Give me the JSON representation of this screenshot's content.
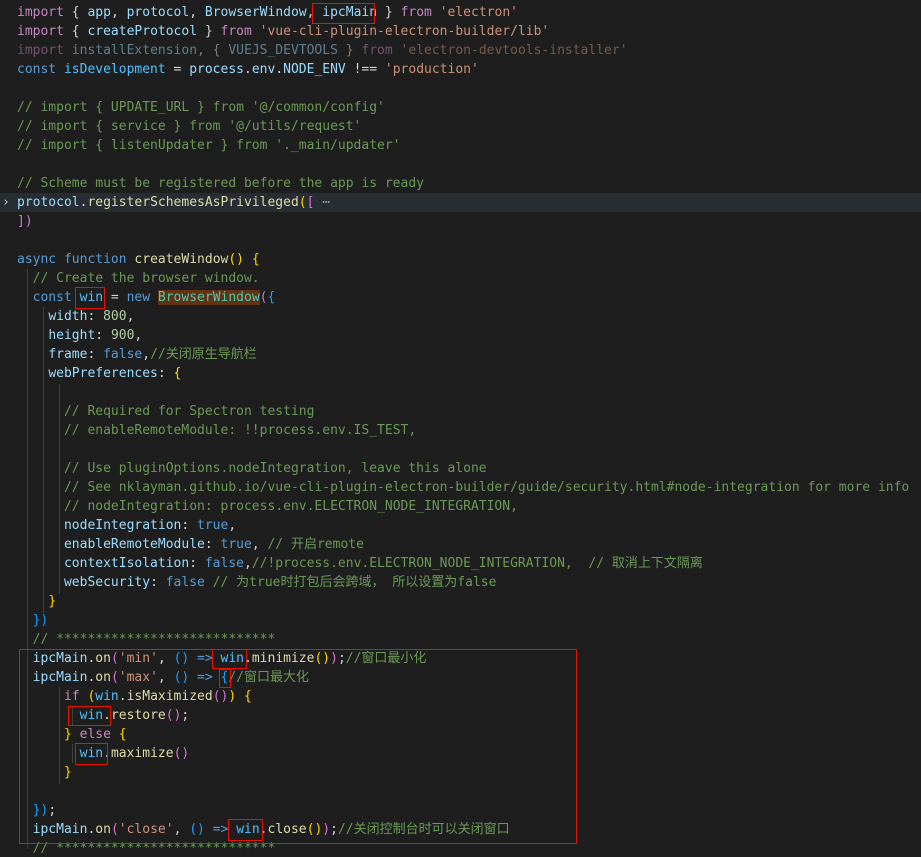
{
  "editor": {
    "lines": [
      [
        [
          "import",
          "ctl"
        ],
        [
          " { ",
          "pun"
        ],
        [
          "app",
          "var"
        ],
        [
          ", ",
          "pun"
        ],
        [
          "protocol",
          "var"
        ],
        [
          ", ",
          "pun"
        ],
        [
          "BrowserWindow",
          "var"
        ],
        [
          ", ",
          "pun"
        ],
        [
          "ipcMain",
          "var"
        ],
        [
          " } ",
          "pun"
        ],
        [
          "from",
          "ctl"
        ],
        [
          " ",
          "pun"
        ],
        [
          "'electron'",
          "str"
        ]
      ],
      [
        [
          "import",
          "ctl"
        ],
        [
          " { ",
          "pun"
        ],
        [
          "createProtocol",
          "var"
        ],
        [
          " } ",
          "pun"
        ],
        [
          "from",
          "ctl"
        ],
        [
          " ",
          "pun"
        ],
        [
          "'vue-cli-plugin-electron-builder/lib'",
          "str"
        ]
      ],
      [
        [
          "import",
          "ctl",
          "dim"
        ],
        [
          " ",
          "pun",
          "dim"
        ],
        [
          "installExtension",
          "var",
          "dim"
        ],
        [
          ", { ",
          "pun",
          "dim"
        ],
        [
          "VUEJS_DEVTOOLS",
          "var",
          "dim"
        ],
        [
          " } ",
          "pun",
          "dim"
        ],
        [
          "from",
          "ctl",
          "dim"
        ],
        [
          " ",
          "pun",
          "dim"
        ],
        [
          "'electron-devtools-installer'",
          "str",
          "dim"
        ]
      ],
      [
        [
          "const",
          "kw"
        ],
        [
          " ",
          "pun"
        ],
        [
          "isDevelopment",
          "const"
        ],
        [
          " = ",
          "pun"
        ],
        [
          "process",
          "var"
        ],
        [
          ".",
          "pun"
        ],
        [
          "env",
          "var"
        ],
        [
          ".",
          "pun"
        ],
        [
          "NODE_ENV",
          "var"
        ],
        [
          " !== ",
          "pun"
        ],
        [
          "'production'",
          "str"
        ]
      ],
      [],
      [
        [
          "// import { UPDATE_URL } from '@/common/config'",
          "cmt"
        ]
      ],
      [
        [
          "// import { service } from '@/utils/request'",
          "cmt"
        ]
      ],
      [
        [
          "// import { listenUpdater } from '._main/updater'",
          "cmt"
        ]
      ],
      [],
      [
        [
          "// Scheme must be registered before the app is ready",
          "cmt"
        ]
      ],
      [
        [
          "protocol",
          "var"
        ],
        [
          ".",
          "pun"
        ],
        [
          "registerSchemesAsPrivileged",
          "fn"
        ],
        [
          "(",
          "br1"
        ],
        [
          "[",
          "br2"
        ],
        [
          " ",
          "pun"
        ],
        [
          "⋯",
          "ell"
        ]
      ],
      [
        [
          "])",
          "br2"
        ]
      ],
      [],
      [
        [
          "async",
          "kw"
        ],
        [
          " ",
          "pun"
        ],
        [
          "function",
          "kw"
        ],
        [
          " ",
          "pun"
        ],
        [
          "createWindow",
          "fn"
        ],
        [
          "()",
          "br1"
        ],
        [
          " ",
          "pun"
        ],
        [
          "{",
          "br1"
        ]
      ],
      [
        [
          "  ",
          "pun"
        ],
        [
          "// Create the browser window.",
          "cmt"
        ]
      ],
      [
        [
          "  ",
          "pun"
        ],
        [
          "const",
          "kw"
        ],
        [
          " ",
          "pun"
        ],
        [
          "win",
          "const"
        ],
        [
          " = ",
          "pun"
        ],
        [
          "new",
          "kw"
        ],
        [
          " ",
          "pun"
        ],
        [
          "BrowserWindow",
          "cls",
          "hl"
        ],
        [
          "(",
          "br2"
        ],
        [
          "{",
          "br3"
        ]
      ],
      [
        [
          "    ",
          "pun"
        ],
        [
          "width",
          "var"
        ],
        [
          ": ",
          "pun"
        ],
        [
          "800",
          "num"
        ],
        [
          ",",
          "pun"
        ]
      ],
      [
        [
          "    ",
          "pun"
        ],
        [
          "height",
          "var"
        ],
        [
          ": ",
          "pun"
        ],
        [
          "900",
          "num"
        ],
        [
          ",",
          "pun"
        ]
      ],
      [
        [
          "    ",
          "pun"
        ],
        [
          "frame",
          "var"
        ],
        [
          ": ",
          "pun"
        ],
        [
          "false",
          "kw"
        ],
        [
          ",",
          "pun"
        ],
        [
          "//关闭原生导航栏",
          "cmt"
        ]
      ],
      [
        [
          "    ",
          "pun"
        ],
        [
          "webPreferences",
          "var"
        ],
        [
          ": ",
          "pun"
        ],
        [
          "{",
          "br1"
        ]
      ],
      [],
      [
        [
          "      ",
          "pun"
        ],
        [
          "// Required for Spectron testing",
          "cmt"
        ]
      ],
      [
        [
          "      ",
          "pun"
        ],
        [
          "// enableRemoteModule: !!process.env.IS_TEST,",
          "cmt"
        ]
      ],
      [],
      [
        [
          "      ",
          "pun"
        ],
        [
          "// Use pluginOptions.nodeIntegration, leave this alone",
          "cmt"
        ]
      ],
      [
        [
          "      ",
          "pun"
        ],
        [
          "// See nklayman.github.io/vue-cli-plugin-electron-builder/guide/security.html#node-integration for more info",
          "cmt"
        ]
      ],
      [
        [
          "      ",
          "pun"
        ],
        [
          "// nodeIntegration: process.env.ELECTRON_NODE_INTEGRATION,",
          "cmt"
        ]
      ],
      [
        [
          "      ",
          "pun"
        ],
        [
          "nodeIntegration",
          "var"
        ],
        [
          ": ",
          "pun"
        ],
        [
          "true",
          "kw"
        ],
        [
          ",",
          "pun"
        ]
      ],
      [
        [
          "      ",
          "pun"
        ],
        [
          "enableRemoteModule",
          "var"
        ],
        [
          ": ",
          "pun"
        ],
        [
          "true",
          "kw"
        ],
        [
          ", ",
          "pun"
        ],
        [
          "// 开启remote",
          "cmt"
        ]
      ],
      [
        [
          "      ",
          "pun"
        ],
        [
          "contextIsolation",
          "var"
        ],
        [
          ": ",
          "pun"
        ],
        [
          "false",
          "kw"
        ],
        [
          ",",
          "pun"
        ],
        [
          "//!process.env.ELECTRON_NODE_INTEGRATION,  // 取消上下文隔离",
          "cmt"
        ]
      ],
      [
        [
          "      ",
          "pun"
        ],
        [
          "webSecurity",
          "var"
        ],
        [
          ": ",
          "pun"
        ],
        [
          "false",
          "kw"
        ],
        [
          " ",
          "pun"
        ],
        [
          "// 为true时打包后会跨域， 所以设置为false",
          "cmt"
        ]
      ],
      [
        [
          "    ",
          "pun"
        ],
        [
          "}",
          "br1"
        ]
      ],
      [
        [
          "  ",
          "pun"
        ],
        [
          "})",
          "br3"
        ]
      ],
      [
        [
          "  ",
          "pun"
        ],
        [
          "// ****************************",
          "cmt"
        ]
      ],
      [
        [
          "  ",
          "pun"
        ],
        [
          "ipcMain",
          "var"
        ],
        [
          ".",
          "pun"
        ],
        [
          "on",
          "fn"
        ],
        [
          "(",
          "br2"
        ],
        [
          "'min'",
          "str"
        ],
        [
          ", ",
          "pun"
        ],
        [
          "()",
          "br3"
        ],
        [
          " ",
          "pun"
        ],
        [
          "=>",
          "kw"
        ],
        [
          " ",
          "pun"
        ],
        [
          "win",
          "const"
        ],
        [
          ".",
          "pun"
        ],
        [
          "minimize",
          "fn"
        ],
        [
          "()",
          "br1"
        ],
        [
          ")",
          "br2"
        ],
        [
          ";",
          "pun"
        ],
        [
          "//窗口最小化",
          "cmt"
        ]
      ],
      [
        [
          "  ",
          "pun"
        ],
        [
          "ipcMain",
          "var"
        ],
        [
          ".",
          "pun"
        ],
        [
          "on",
          "fn"
        ],
        [
          "(",
          "br2"
        ],
        [
          "'max'",
          "str"
        ],
        [
          ", ",
          "pun"
        ],
        [
          "()",
          "br3"
        ],
        [
          " ",
          "pun"
        ],
        [
          "=>",
          "kw"
        ],
        [
          " ",
          "pun"
        ],
        [
          "{",
          "br3"
        ],
        [
          "//窗口最大化",
          "cmt"
        ]
      ],
      [
        [
          "      ",
          "pun"
        ],
        [
          "if",
          "ctl"
        ],
        [
          " ",
          "pun"
        ],
        [
          "(",
          "br1"
        ],
        [
          "win",
          "const"
        ],
        [
          ".",
          "pun"
        ],
        [
          "isMaximized",
          "fn"
        ],
        [
          "()",
          "br2"
        ],
        [
          ")",
          "br1"
        ],
        [
          " ",
          "pun"
        ],
        [
          "{",
          "br1"
        ]
      ],
      [
        [
          "        ",
          "pun"
        ],
        [
          "win",
          "const"
        ],
        [
          ".",
          "pun"
        ],
        [
          "restore",
          "fn"
        ],
        [
          "()",
          "br2"
        ],
        [
          ";",
          "pun"
        ]
      ],
      [
        [
          "      ",
          "pun"
        ],
        [
          "}",
          "br1"
        ],
        [
          " ",
          "pun"
        ],
        [
          "else",
          "ctl"
        ],
        [
          " ",
          "pun"
        ],
        [
          "{",
          "br1"
        ]
      ],
      [
        [
          "        ",
          "pun"
        ],
        [
          "win",
          "const"
        ],
        [
          ".",
          "pun"
        ],
        [
          "maximize",
          "fn"
        ],
        [
          "()",
          "br2"
        ]
      ],
      [
        [
          "      ",
          "pun"
        ],
        [
          "}",
          "br1"
        ]
      ],
      [],
      [
        [
          "  ",
          "pun"
        ],
        [
          "})",
          "br3"
        ],
        [
          ";",
          "pun"
        ]
      ],
      [
        [
          "  ",
          "pun"
        ],
        [
          "ipcMain",
          "var"
        ],
        [
          ".",
          "pun"
        ],
        [
          "on",
          "fn"
        ],
        [
          "(",
          "br2"
        ],
        [
          "'close'",
          "str"
        ],
        [
          ", ",
          "pun"
        ],
        [
          "()",
          "br3"
        ],
        [
          " ",
          "pun"
        ],
        [
          "=>",
          "kw"
        ],
        [
          " ",
          "pun"
        ],
        [
          "win",
          "const"
        ],
        [
          ".",
          "pun"
        ],
        [
          "close",
          "fn"
        ],
        [
          "()",
          "br1"
        ],
        [
          ")",
          "br2"
        ],
        [
          ";",
          "pun"
        ],
        [
          "//关闭控制台时可以关闭窗口",
          "cmt"
        ]
      ],
      [
        [
          "  ",
          "pun"
        ],
        [
          "// ****************************",
          "cmt"
        ]
      ]
    ]
  }
}
